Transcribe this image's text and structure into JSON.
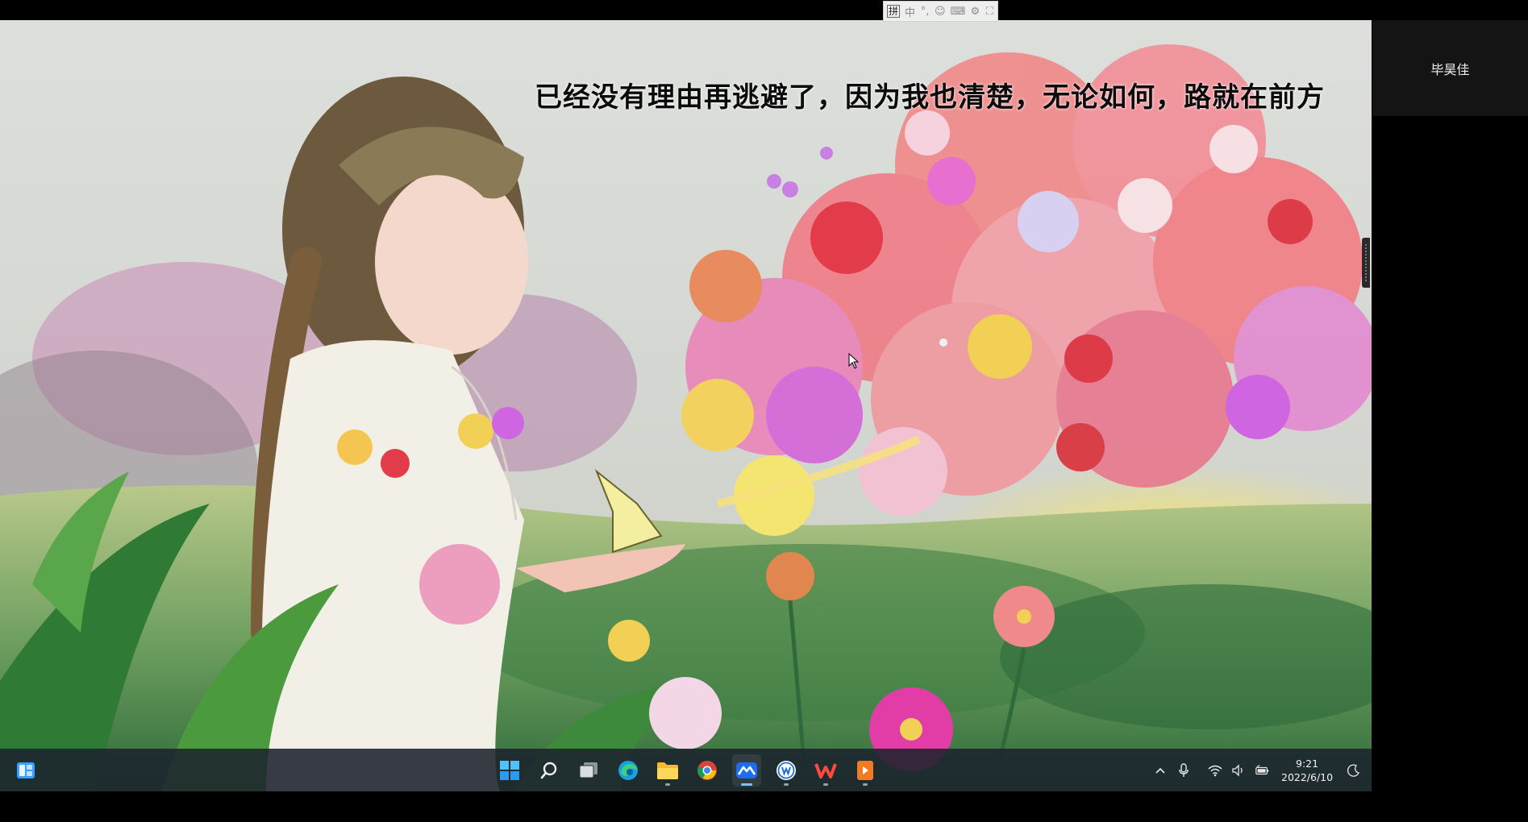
{
  "wallpaper": {
    "lyric": "已经没有理由再逃避了，因为我也清楚，无论如何，路就在前方"
  },
  "ime_toolbar": {
    "items": [
      "拼",
      "中",
      "°,",
      "☺",
      "⌨",
      "⚙",
      "⛶"
    ]
  },
  "participant": {
    "name": "毕昊佳"
  },
  "taskbar": {
    "apps": [
      {
        "name": "start",
        "running": false
      },
      {
        "name": "search",
        "running": false
      },
      {
        "name": "task-view",
        "running": false
      },
      {
        "name": "edge",
        "running": false
      },
      {
        "name": "file-explorer",
        "running": true
      },
      {
        "name": "chrome",
        "running": false
      },
      {
        "name": "meeting-app",
        "running": true
      },
      {
        "name": "word-app",
        "running": true
      },
      {
        "name": "wps-office",
        "running": true
      },
      {
        "name": "slides-app",
        "running": true
      }
    ],
    "clock": {
      "time": "9:21",
      "date": "2022/6/10"
    }
  },
  "colors": {
    "taskbar_bg": "#1c232d",
    "accent": "#3aa0ff",
    "lyric_text": "#0b0b0b"
  }
}
